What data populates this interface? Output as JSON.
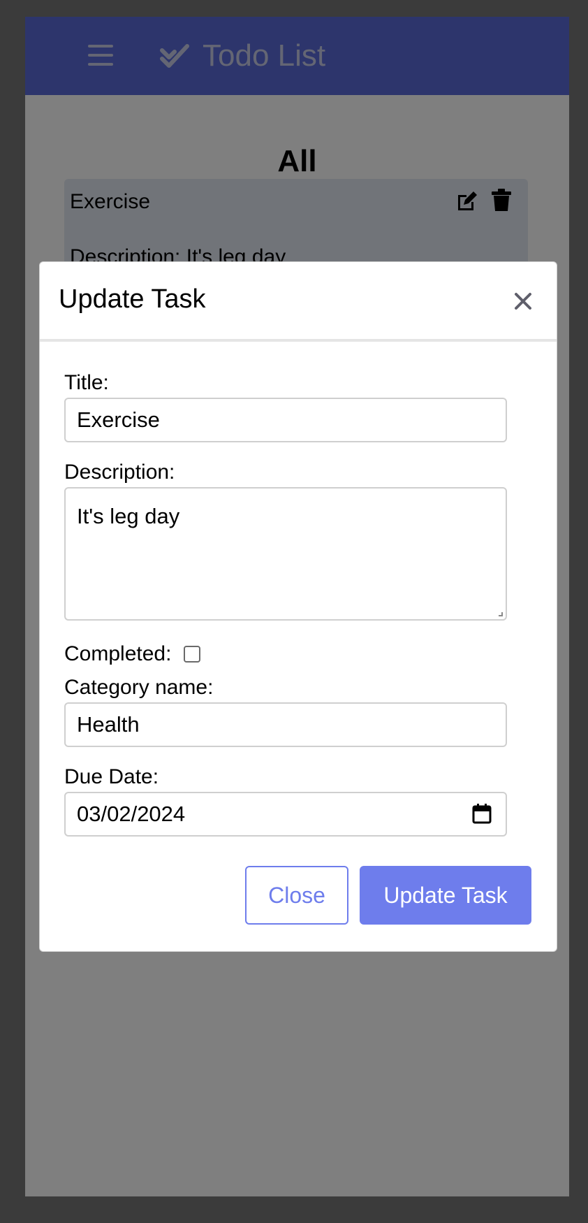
{
  "navbar": {
    "brand": "Todo List",
    "menu_icon": "hamburger-menu-icon",
    "brand_icon": "double-check-icon",
    "background": "#5b6ad8"
  },
  "page": {
    "section_title": "All"
  },
  "task_card": {
    "title": "Exercise",
    "description": "Description: It's leg day",
    "edit_icon": "edit-icon",
    "delete_icon": "trash-icon"
  },
  "modal": {
    "title": "Update Task",
    "close_icon": "close-icon",
    "fields": {
      "title_label": "Title:",
      "title_value": "Exercise",
      "description_label": "Description:",
      "description_value": "It's leg day",
      "completed_label": "Completed:",
      "completed": false,
      "category_label": "Category name:",
      "category_value": "Health",
      "due_date_label": "Due Date:",
      "due_date_value": "03/02/2024"
    },
    "buttons": {
      "close": "Close",
      "update": "Update Task"
    },
    "accent": "#6e7dec"
  }
}
